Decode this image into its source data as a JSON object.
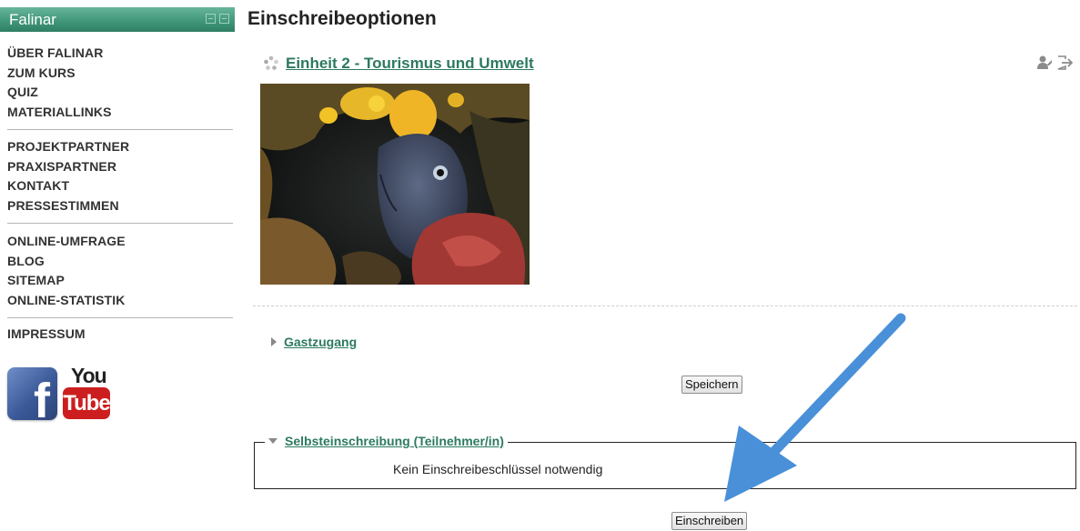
{
  "sidebar": {
    "title": "Falinar",
    "groups": [
      [
        "ÜBER FALINAR",
        "ZUM KURS",
        "QUIZ",
        "MATERIALLINKS"
      ],
      [
        "PROJEKTPARTNER",
        "PRAXISPARTNER",
        "KONTAKT",
        "PRESSESTIMMEN"
      ],
      [
        "ONLINE-UMFRAGE",
        "BLOG",
        "SITEMAP",
        "ONLINE-STATISTIK"
      ],
      [
        "IMPRESSUM"
      ]
    ],
    "social": {
      "facebook_letter": "f",
      "youtube_top": "You",
      "youtube_bottom": "Tube"
    }
  },
  "main": {
    "page_title": "Einschreibeoptionen",
    "course_name": "Einheit 2 - Tourismus und Umwelt",
    "guest_access": {
      "label": "Gastzugang",
      "save_button": "Speichern"
    },
    "self_enrolment": {
      "label": "Selbsteinschreibung (Teilnehmer/in)",
      "note": "Kein Einschreibeschlüssel notwendig",
      "enrol_button": "Einschreiben"
    }
  },
  "colors": {
    "link": "#2c7a5f",
    "header_green": "#3f9478",
    "arrow_blue": "#4a90d9"
  },
  "icons": [
    "course-icon",
    "user-enrol-icon",
    "logout-icon",
    "collapsed-triangle-icon",
    "expanded-triangle-icon",
    "annotation-arrow"
  ]
}
